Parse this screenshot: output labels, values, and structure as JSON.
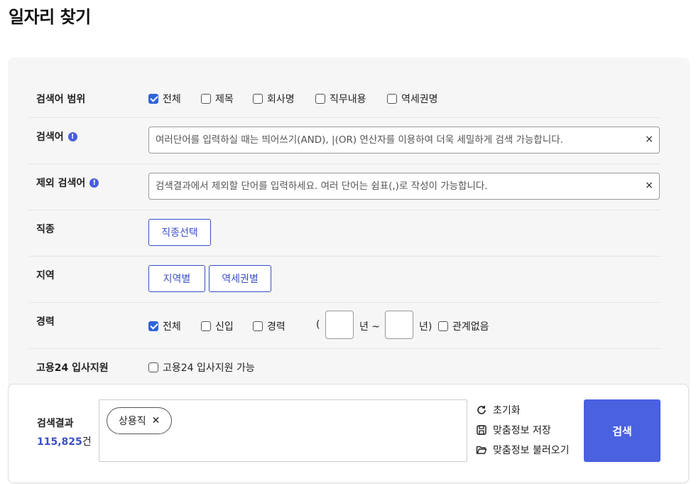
{
  "page": {
    "title": "일자리 찾기"
  },
  "scope": {
    "label": "검색어 범위",
    "options": [
      {
        "label": "전체",
        "checked": true
      },
      {
        "label": "제목",
        "checked": false
      },
      {
        "label": "회사명",
        "checked": false
      },
      {
        "label": "직무내용",
        "checked": false
      },
      {
        "label": "역세권명",
        "checked": false
      }
    ]
  },
  "keyword": {
    "label": "검색어",
    "placeholder": "여러단어를 입력하실 때는 띄어쓰기(AND), |(OR) 연산자를 이용하여 더욱 세밀하게 검색 가능합니다.",
    "clear": "×"
  },
  "exclude": {
    "label": "제외 검색어",
    "placeholder": "검색결과에서 제외할 단어를 입력하세요. 여러 단어는 쉼표(,)로 작성이 가능합니다.",
    "clear": "×"
  },
  "job": {
    "label": "직종",
    "button": "직종선택"
  },
  "region": {
    "label": "지역",
    "buttons": [
      "지역별",
      "역세권별"
    ]
  },
  "career": {
    "label": "경력",
    "options": [
      {
        "label": "전체",
        "checked": true
      },
      {
        "label": "신입",
        "checked": false
      },
      {
        "label": "경력",
        "checked": false
      }
    ],
    "open_paren": "(",
    "year_sep": "년 ~",
    "year_close": "년)",
    "any": {
      "label": "관계없음",
      "checked": false
    }
  },
  "employ24": {
    "label": "고용24 입사지원",
    "option": {
      "label": "고용24 입사지원 가능",
      "checked": false
    }
  },
  "results": {
    "label": "검색결과",
    "count": "115,825",
    "unit": "건",
    "tags": [
      {
        "label": "상용직",
        "remove": "✕"
      }
    ],
    "actions": {
      "reset": "초기화",
      "save": "맞춤정보 저장",
      "load": "맞춤정보 불러오기"
    },
    "search_button": "검색"
  }
}
